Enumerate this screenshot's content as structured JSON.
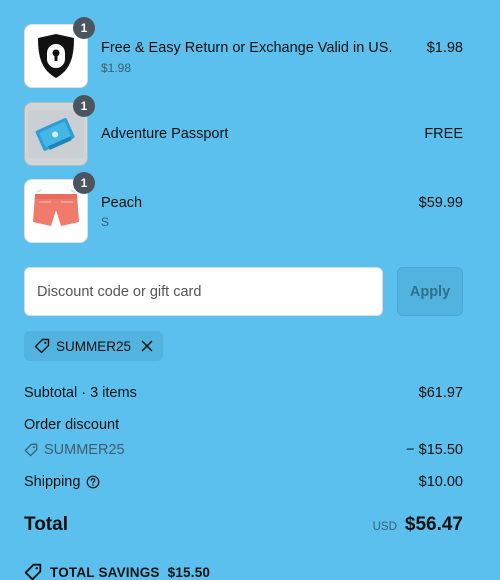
{
  "items": [
    {
      "name": "Free & Easy Return or Exchange Valid in US.",
      "variant": "$1.98",
      "price": "$1.98",
      "quantity": "1",
      "image": "shield-lock-icon"
    },
    {
      "name": "Adventure Passport",
      "variant": "",
      "price": "FREE",
      "quantity": "1",
      "image": "passport-image"
    },
    {
      "name": "Peach",
      "variant": "S",
      "price": "$59.99",
      "quantity": "1",
      "image": "swim-shorts-image"
    }
  ],
  "discount": {
    "placeholder": "Discount code or gift card",
    "value": "",
    "apply_label": "Apply",
    "applied_code": "SUMMER25"
  },
  "summary": {
    "subtotal_label": "Subtotal · 3 items",
    "subtotal_value": "$61.97",
    "order_discount_label": "Order discount",
    "discount_code": "SUMMER25",
    "discount_value": "− $15.50",
    "shipping_label": "Shipping",
    "shipping_value": "$10.00",
    "total_label": "Total",
    "currency": "USD",
    "total_value": "$56.47",
    "savings_label": "TOTAL SAVINGS",
    "savings_value": "$15.50"
  },
  "colors": {
    "background": "#5bc0ed",
    "badge": "#4a5560",
    "muted_text": "#3d5e70"
  }
}
